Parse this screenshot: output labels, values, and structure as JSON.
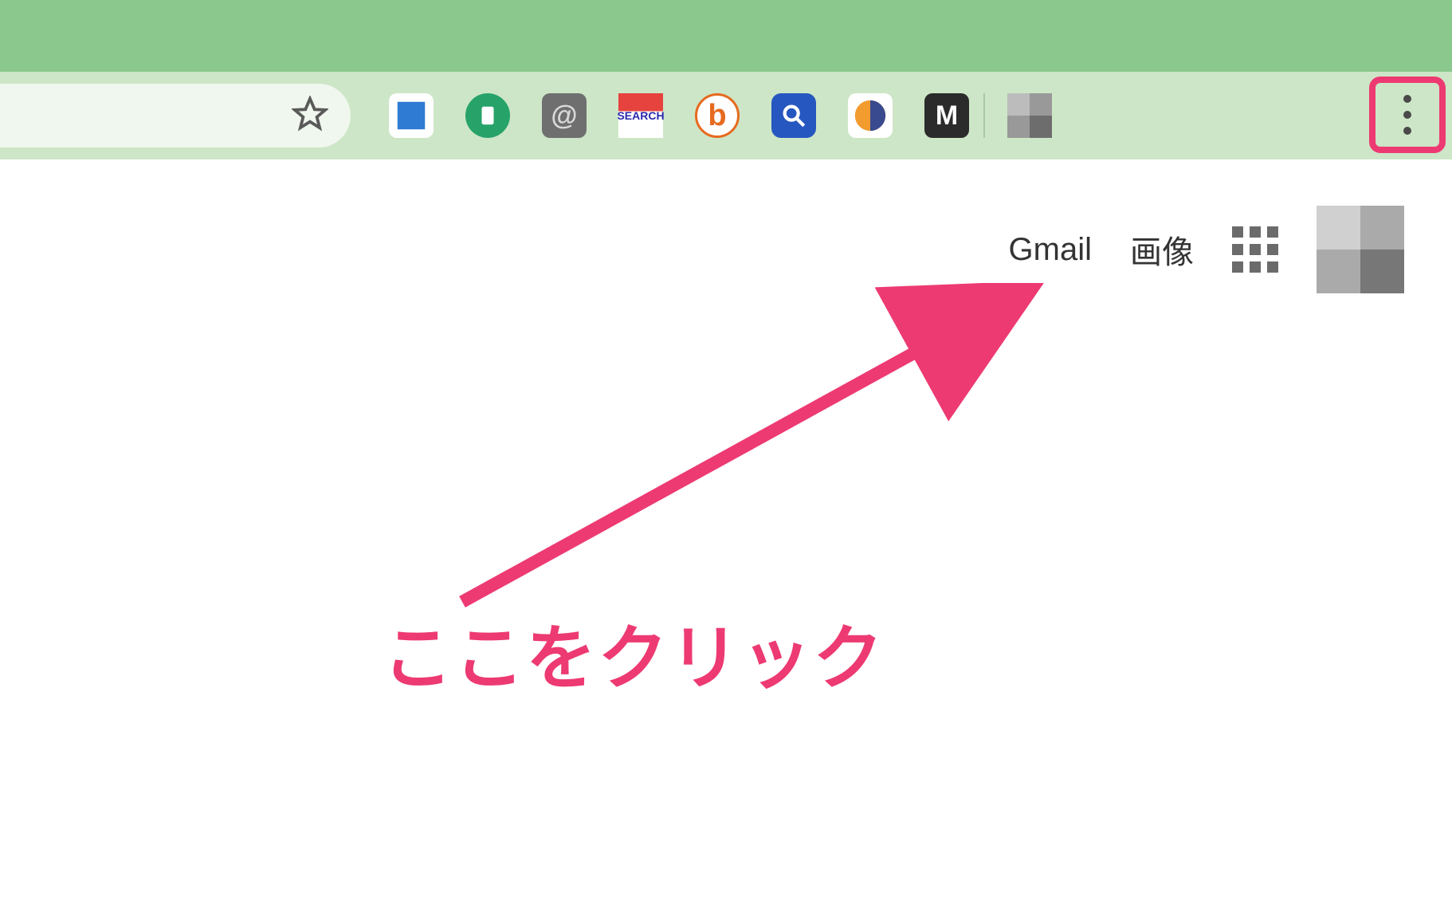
{
  "browser": {
    "toolbar": {
      "address_bar": {
        "star_title": "Bookmark"
      },
      "extensions": [
        {
          "name": "gyazo-extension"
        },
        {
          "name": "pushbullet-extension"
        },
        {
          "name": "at-extension"
        },
        {
          "name": "search-extension"
        },
        {
          "name": "bitly-extension"
        },
        {
          "name": "search-magnifier-extension"
        },
        {
          "name": "similarweb-extension"
        },
        {
          "name": "mega-extension"
        }
      ],
      "profile": {
        "label": "Profile"
      },
      "menu": {
        "label": "Menu"
      }
    }
  },
  "page": {
    "nav": {
      "gmail": "Gmail",
      "images": "画像",
      "apps_label": "Google apps",
      "account_label": "Account"
    }
  },
  "annotation": {
    "text": "ここをクリック",
    "color": "#ed3a72"
  }
}
